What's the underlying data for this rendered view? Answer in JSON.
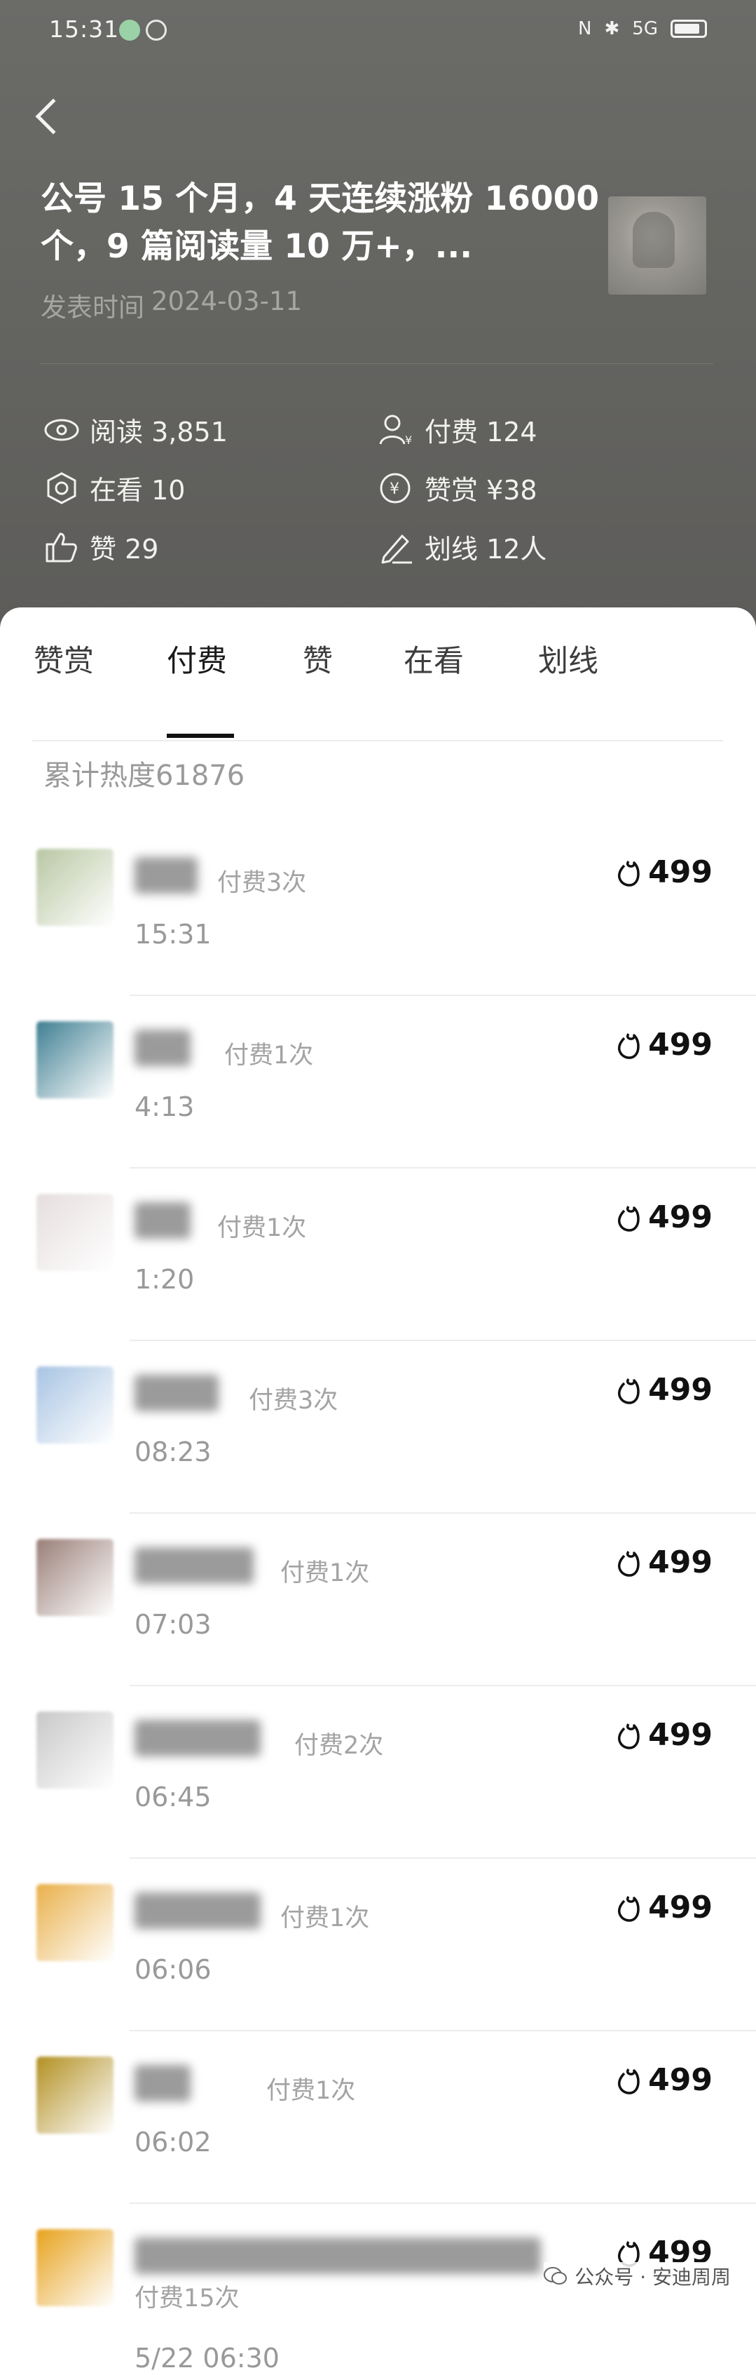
{
  "status_bar": {
    "time": "15:31",
    "network": "5G"
  },
  "article": {
    "title": "公号 15 个月，4 天连续涨粉 16000个，9 篇阅读量 10 万+，...",
    "publish_label": "发表时间",
    "publish_date": "2024-03-11"
  },
  "stats": {
    "read": "阅读 3,851",
    "pay": "付费 124",
    "looking": "在看 10",
    "reward": "赞赏 ¥38",
    "like": "赞 29",
    "highlight": "划线 12人"
  },
  "tabs": [
    "赞赏",
    "付费",
    "赞",
    "在看",
    "划线"
  ],
  "active_tab": "付费",
  "heat": "累计热度61876",
  "rows": [
    {
      "pay": "付费3次",
      "time": "15:31",
      "amount": "499",
      "avatar_color": "#b9c7a3"
    },
    {
      "pay": "付费1次",
      "time": "4:13",
      "amount": "499",
      "avatar_color": "#3f7f92"
    },
    {
      "pay": "付费1次",
      "time": "1:20",
      "amount": "499",
      "avatar_color": "#e6dede"
    },
    {
      "pay": "付费3次",
      "time": "08:23",
      "amount": "499",
      "avatar_color": "#a8c4e3"
    },
    {
      "pay": "付费1次",
      "time": "07:03",
      "amount": "499",
      "avatar_color": "#9a7f78"
    },
    {
      "pay": "付费2次",
      "time": "06:45",
      "amount": "499",
      "avatar_color": "#c8c8c8"
    },
    {
      "pay": "付费1次",
      "time": "06:06",
      "amount": "499",
      "avatar_color": "#e9b04a"
    },
    {
      "pay": "付费1次",
      "time": "06:02",
      "amount": "499",
      "avatar_color": "#b29022"
    },
    {
      "pay": "付费15次",
      "time": "5/22 06:30",
      "amount": "499",
      "avatar_color": "#e7a21c"
    }
  ],
  "watermark": "公众号 · 安迪周周"
}
